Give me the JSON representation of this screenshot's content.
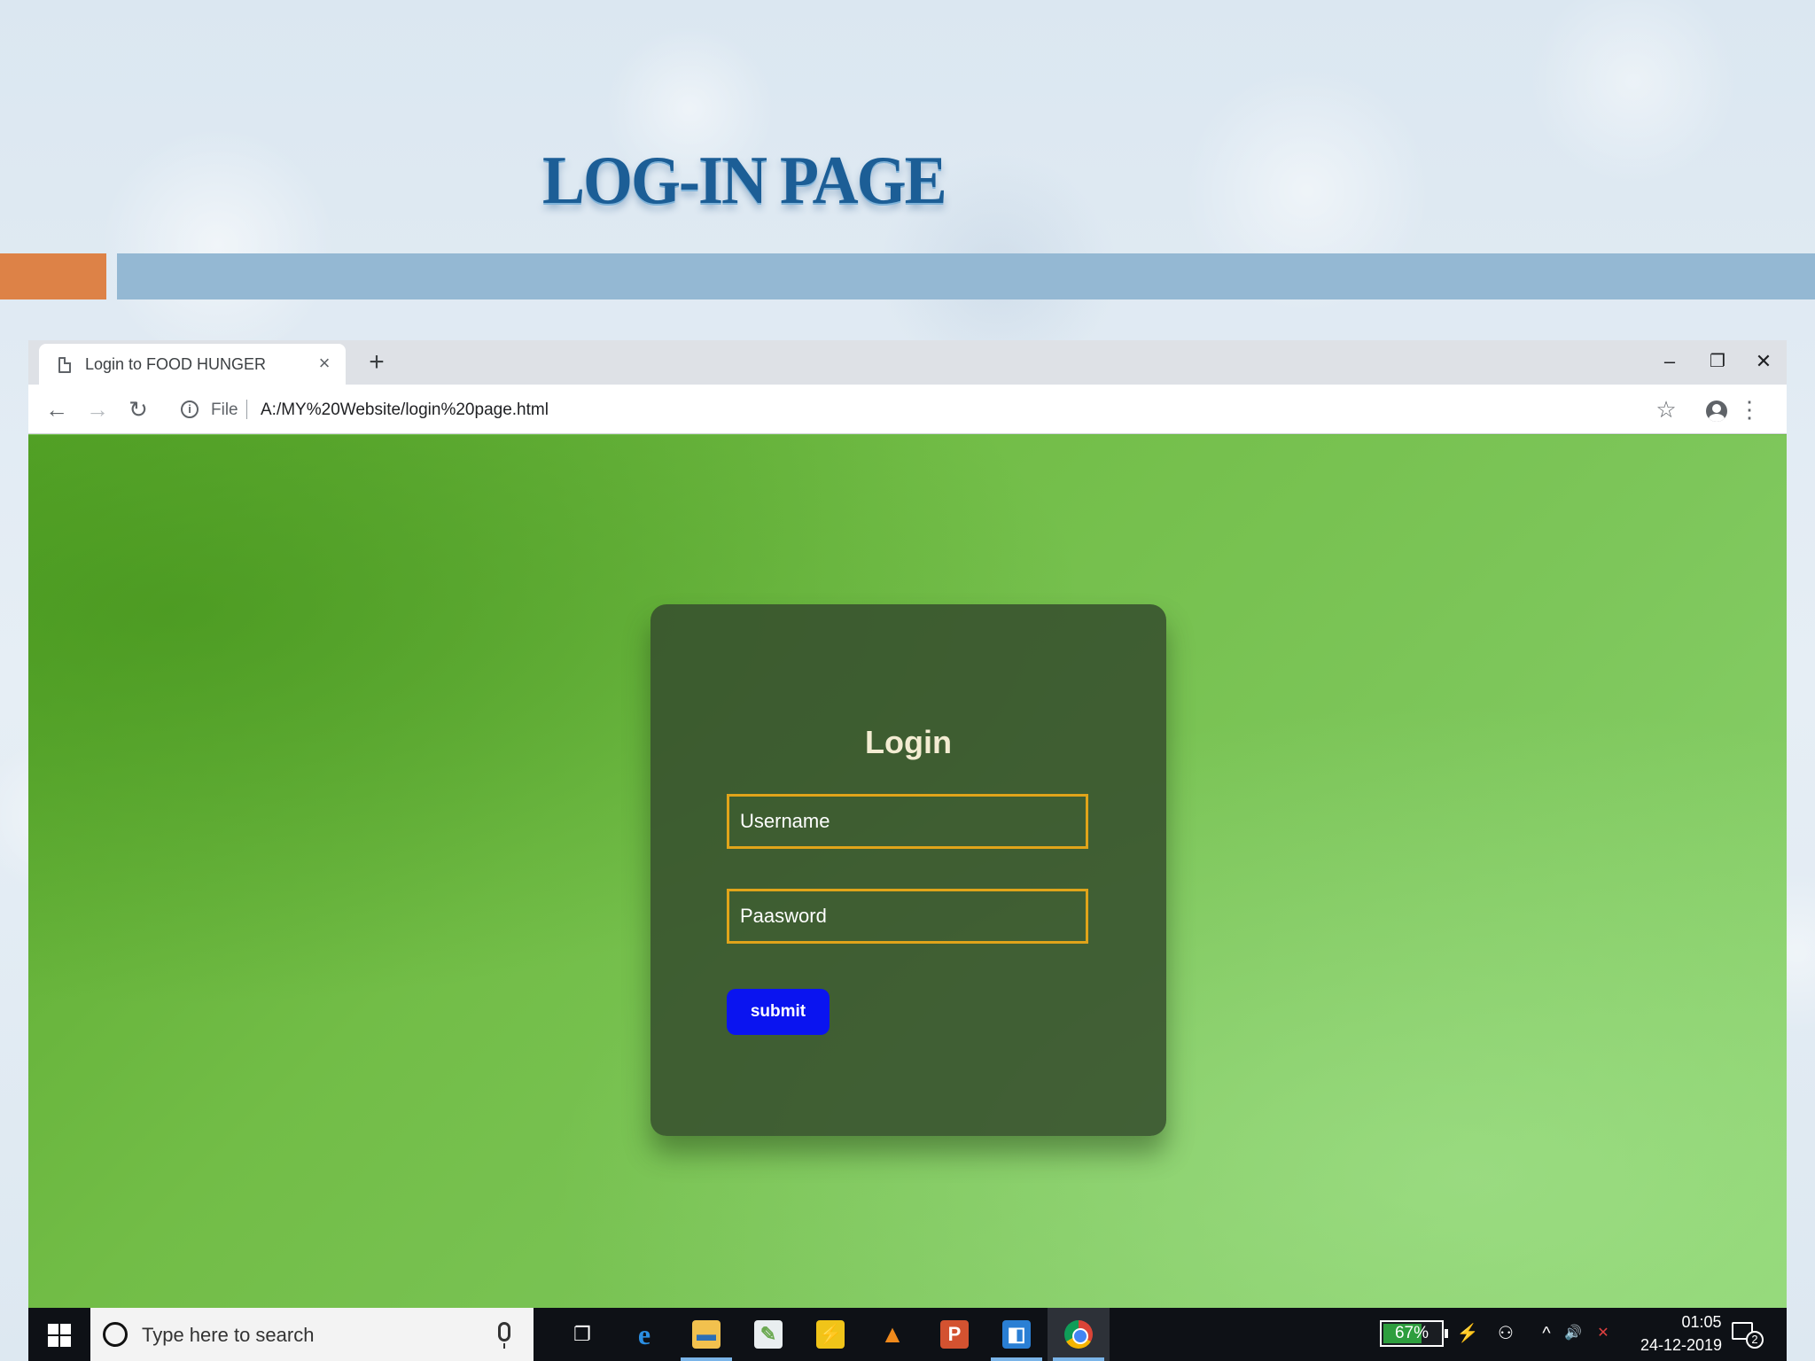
{
  "slide": {
    "title": "LOG-IN PAGE",
    "accent_orange": "#dd8247",
    "accent_blue": "#94b8d3"
  },
  "browser": {
    "tab": {
      "title": "Login to FOOD HUNGER",
      "close_glyph": "×",
      "icon": "page-icon"
    },
    "new_tab_glyph": "+",
    "window_controls": {
      "minimize": "–",
      "restore": "❐",
      "close": "✕"
    },
    "toolbar": {
      "back_glyph": "←",
      "forward_glyph": "→",
      "reload_glyph": "↻",
      "info_glyph": "i",
      "scheme": "File",
      "url": "A:/MY%20Website/login%20page.html",
      "bookmark_glyph": "☆",
      "menu_glyph": "⋮"
    }
  },
  "page": {
    "background_color": "#72bd47",
    "login": {
      "heading": "Login",
      "username_placeholder": "Username",
      "password_placeholder": "Paasword",
      "submit_label": "submit",
      "field_border_color": "#e0a41a",
      "button_color": "#0a14f0"
    }
  },
  "taskbar": {
    "search_placeholder": "Type here to search",
    "apps": [
      {
        "name": "task-view",
        "glyph": "❐"
      },
      {
        "name": "edge",
        "glyph": "e"
      },
      {
        "name": "file-explorer",
        "glyph": "▬"
      },
      {
        "name": "notepad-plus",
        "glyph": "✎"
      },
      {
        "name": "app-yellow",
        "glyph": "⚡"
      },
      {
        "name": "vlc",
        "glyph": "▲"
      },
      {
        "name": "powerpoint",
        "glyph": "P"
      },
      {
        "name": "app-blue",
        "glyph": "◧"
      },
      {
        "name": "chrome",
        "glyph": ""
      }
    ],
    "battery_percent": "67%",
    "battery_level": 0.67,
    "tray": {
      "plug_glyph": "⚡",
      "people_glyph": "⚇",
      "chevron_glyph": "^",
      "volume_glyph": "🔊",
      "network_glyph": "✕"
    },
    "time": "01:05",
    "date": "24-12-2019",
    "notification_count": "2"
  }
}
